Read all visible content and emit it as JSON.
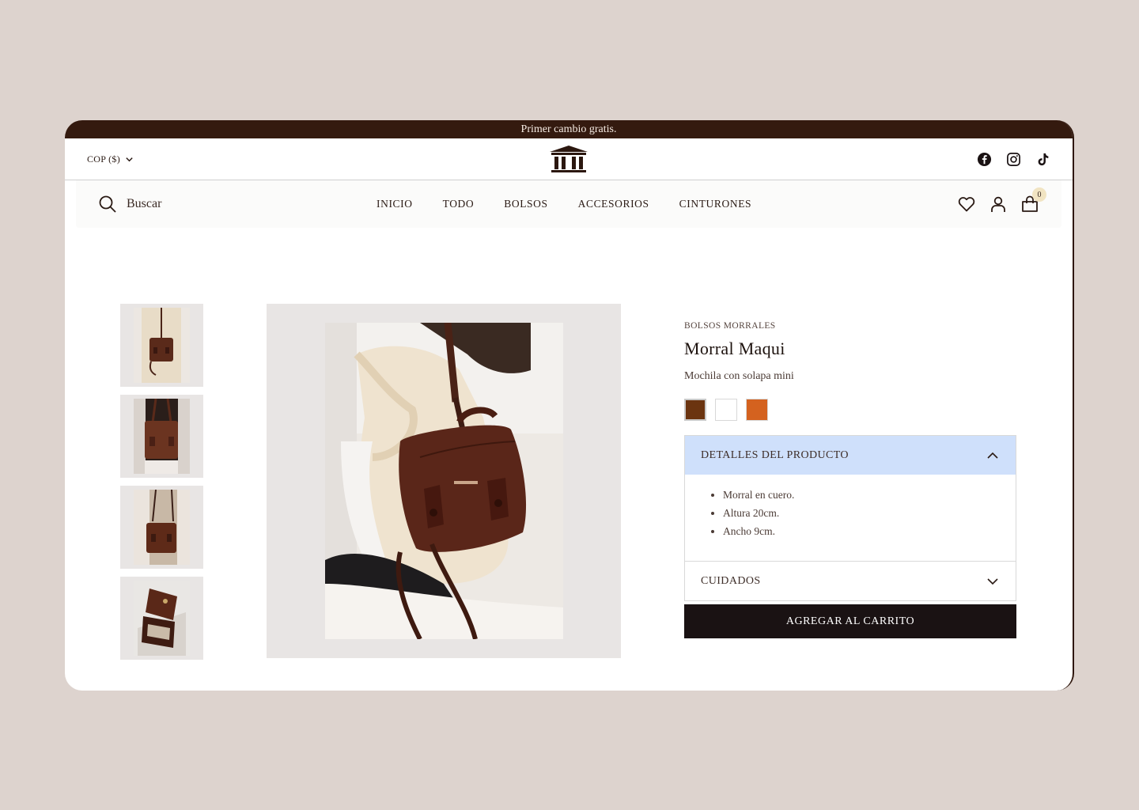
{
  "announcement": "Primer cambio gratis.",
  "header": {
    "currency": "COP ($)",
    "socials": [
      "facebook-icon",
      "instagram-icon",
      "tiktok-icon"
    ]
  },
  "nav": {
    "search_placeholder": "Buscar",
    "items": [
      "INICIO",
      "TODO",
      "BOLSOS",
      "ACCESORIOS",
      "CINTURONES"
    ],
    "cart_count": "0"
  },
  "product": {
    "breadcrumb": "BOLSOS MORRALES",
    "name": "Morral Maqui",
    "subtitle": "Mochila con solapa mini",
    "colors": [
      "#6b3410",
      "#ffffff",
      "#d4621f"
    ],
    "details": {
      "title": "DETALLES DEL PRODUCTO",
      "items": [
        "Morral en cuero.",
        "Altura 20cm.",
        "Ancho 9cm."
      ]
    },
    "care": {
      "title": "CUIDADOS"
    },
    "add_to_cart": "AGREGAR AL CARRITO"
  },
  "colors": {
    "announcement_bg": "#341a0f",
    "page_bg": "#ddd3ce",
    "accordion_active": "#cfe0fb",
    "cta_bg": "#1a1213"
  }
}
